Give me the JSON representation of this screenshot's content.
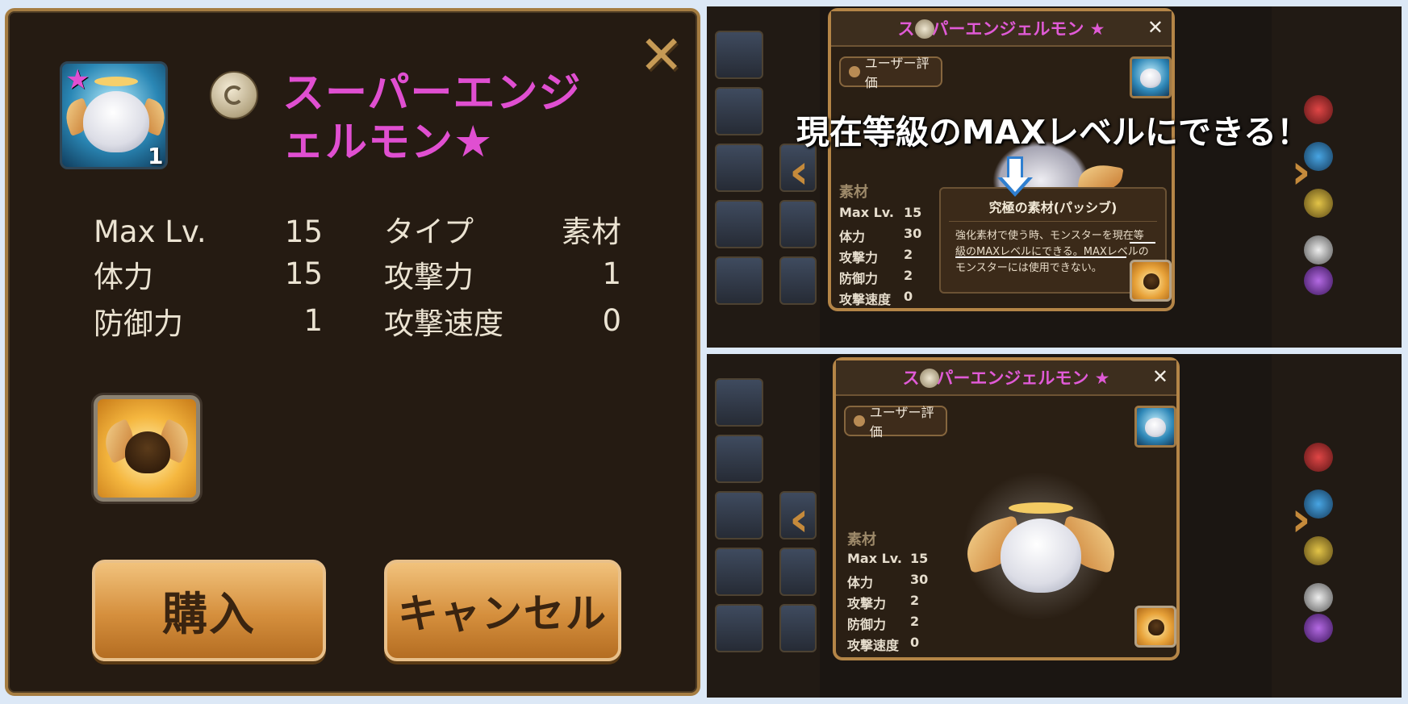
{
  "left_panel": {
    "monster_name": "スーパーエンジェルモン",
    "name_line1": "スーパーエンジ",
    "name_line2": "ェルモン",
    "star_glyph": "★",
    "monster_level": "1",
    "close_glyph": "✕",
    "stats": [
      {
        "label": "Max Lv.",
        "value": "15"
      },
      {
        "label": "体力",
        "value": "15"
      },
      {
        "label": "防御力",
        "value": "1"
      },
      {
        "label": "タイプ",
        "value": "素材"
      },
      {
        "label": "攻撃力",
        "value": "1"
      },
      {
        "label": "攻撃速度",
        "value": "0"
      }
    ],
    "buy_label": "購入",
    "cancel_label": "キャンセル"
  },
  "right_top": {
    "title": "スーパーエンジェルモン ★",
    "close_glyph": "✕",
    "rating_label": "ユーザー評価",
    "callout": "現在等級のMAXレベルにできる！",
    "type_label": "素材",
    "stats": [
      {
        "label": "Max Lv.",
        "value": "15"
      },
      {
        "label": "体力",
        "value": "30"
      },
      {
        "label": "攻撃力",
        "value": "2"
      },
      {
        "label": "防御力",
        "value": "2"
      },
      {
        "label": "攻撃速度",
        "value": "0"
      }
    ],
    "tooltip_title": "究極の素材(パッシブ)",
    "tooltip_text": "強化素材で使う時、モンスターを現在等級のMAXレベルにできる。MAXレベルのモンスターには使用できない。"
  },
  "right_bottom": {
    "title": "スーパーエンジェルモン ★",
    "close_glyph": "✕",
    "rating_label": "ユーザー評価",
    "type_label": "素材",
    "stats": [
      {
        "label": "Max Lv.",
        "value": "15"
      },
      {
        "label": "体力",
        "value": "30"
      },
      {
        "label": "攻撃力",
        "value": "2"
      },
      {
        "label": "防御力",
        "value": "2"
      },
      {
        "label": "攻撃速度",
        "value": "0"
      }
    ]
  },
  "colors": {
    "name_pink": "#e04fd1",
    "panel_border": "#a57d42",
    "button_gold": "#d58f3d"
  },
  "icons": [
    "close-icon",
    "star-icon",
    "element-light-icon",
    "skill-icon",
    "chevron-left-icon",
    "chevron-right-icon",
    "down-arrow-icon"
  ]
}
